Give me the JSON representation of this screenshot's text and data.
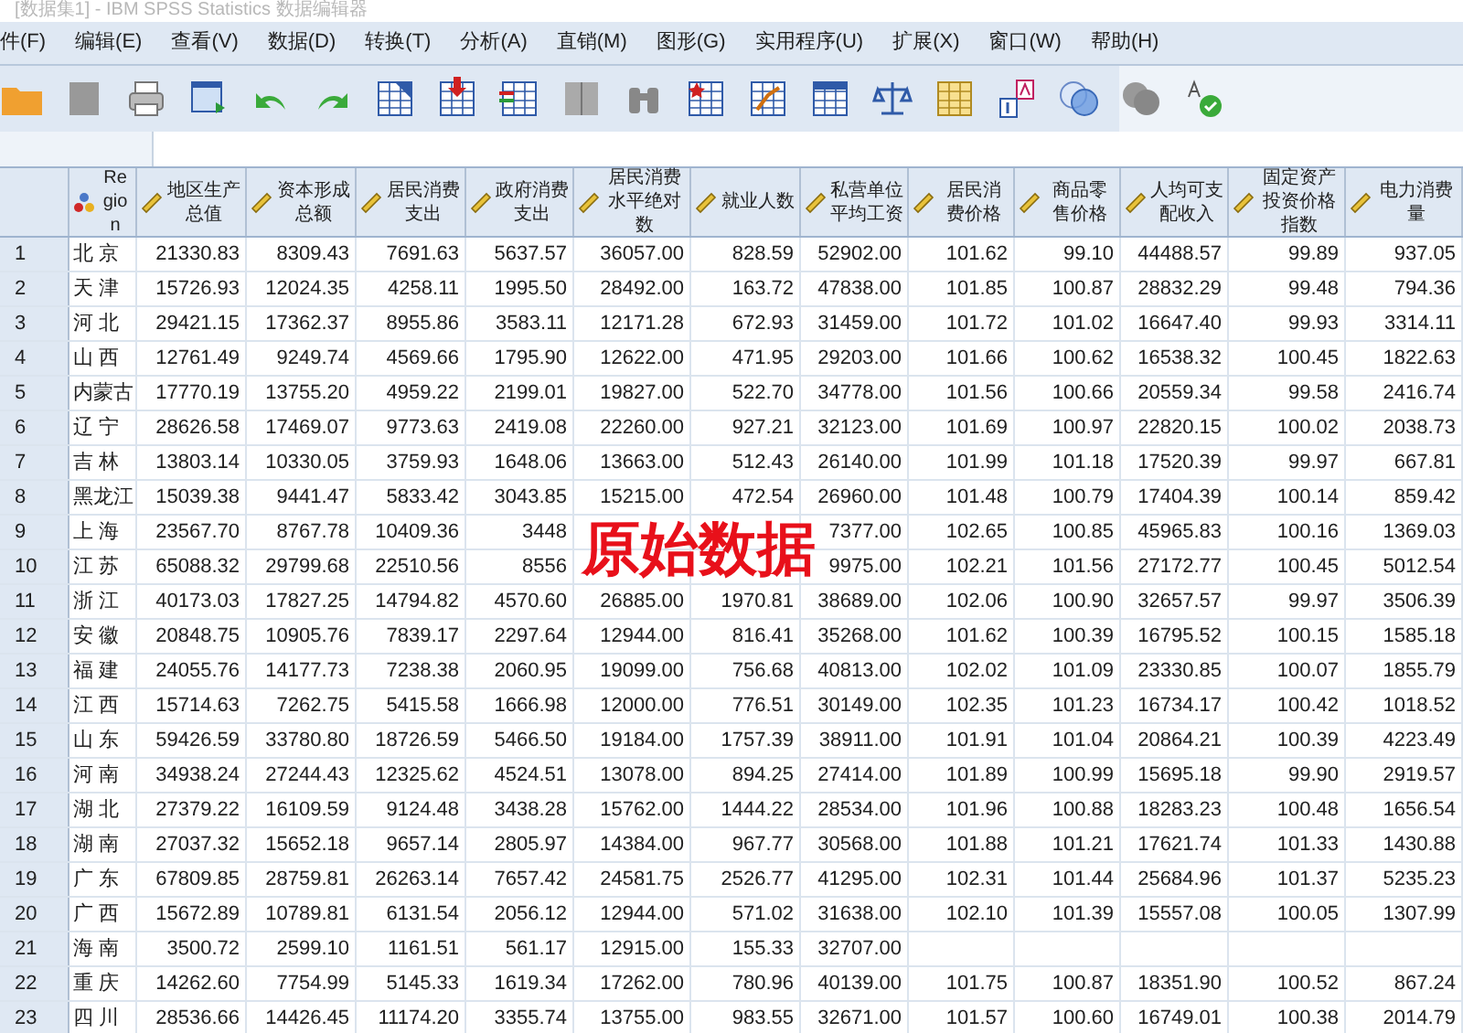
{
  "window": {
    "title": "[数据集1] - IBM SPSS Statistics 数据编辑器"
  },
  "menu": [
    "件(F)",
    "编辑(E)",
    "查看(V)",
    "数据(D)",
    "转换(T)",
    "分析(A)",
    "直销(M)",
    "图形(G)",
    "实用程序(U)",
    "扩展(X)",
    "窗口(W)",
    "帮助(H)"
  ],
  "table": {
    "columns": [
      {
        "label": "Region",
        "kind": "nominal"
      },
      {
        "label": "地区生产总值",
        "kind": "scale"
      },
      {
        "label": "资本形成总额",
        "kind": "scale"
      },
      {
        "label": "居民消费支出",
        "kind": "scale"
      },
      {
        "label": "政府消费支出",
        "kind": "scale"
      },
      {
        "label": "居民消费水平绝对数",
        "kind": "scale"
      },
      {
        "label": "就业人数",
        "kind": "scale"
      },
      {
        "label": "私营单位平均工资",
        "kind": "scale"
      },
      {
        "label": "居民消费价格",
        "kind": "scale"
      },
      {
        "label": "商品零售价格",
        "kind": "scale"
      },
      {
        "label": "人均可支配收入",
        "kind": "scale"
      },
      {
        "label": "固定资产投资价格指数",
        "kind": "scale"
      },
      {
        "label": "电力消费量",
        "kind": "scale"
      }
    ],
    "rows": [
      {
        "num": "1",
        "cells": [
          "北 京",
          "21330.83",
          "8309.43",
          "7691.63",
          "5637.57",
          "36057.00",
          "828.59",
          "52902.00",
          "101.62",
          "99.10",
          "44488.57",
          "99.89",
          "937.05"
        ]
      },
      {
        "num": "2",
        "cells": [
          "天 津",
          "15726.93",
          "12024.35",
          "4258.11",
          "1995.50",
          "28492.00",
          "163.72",
          "47838.00",
          "101.85",
          "100.87",
          "28832.29",
          "99.48",
          "794.36"
        ]
      },
      {
        "num": "3",
        "cells": [
          "河 北",
          "29421.15",
          "17362.37",
          "8955.86",
          "3583.11",
          "12171.28",
          "672.93",
          "31459.00",
          "101.72",
          "101.02",
          "16647.40",
          "99.93",
          "3314.11"
        ]
      },
      {
        "num": "4",
        "cells": [
          "山 西",
          "12761.49",
          "9249.74",
          "4569.66",
          "1795.90",
          "12622.00",
          "471.95",
          "29203.00",
          "101.66",
          "100.62",
          "16538.32",
          "100.45",
          "1822.63"
        ]
      },
      {
        "num": "5",
        "cells": [
          "内蒙古",
          "17770.19",
          "13755.20",
          "4959.22",
          "2199.01",
          "19827.00",
          "522.70",
          "34778.00",
          "101.56",
          "100.66",
          "20559.34",
          "99.58",
          "2416.74"
        ]
      },
      {
        "num": "6",
        "cells": [
          "辽 宁",
          "28626.58",
          "17469.07",
          "9773.63",
          "2419.08",
          "22260.00",
          "927.21",
          "32123.00",
          "101.69",
          "100.97",
          "22820.15",
          "100.02",
          "2038.73"
        ]
      },
      {
        "num": "7",
        "cells": [
          "吉 林",
          "13803.14",
          "10330.05",
          "3759.93",
          "1648.06",
          "13663.00",
          "512.43",
          "26140.00",
          "101.99",
          "101.18",
          "17520.39",
          "99.97",
          "667.81"
        ]
      },
      {
        "num": "8",
        "cells": [
          "黑龙江",
          "15039.38",
          "9441.47",
          "5833.42",
          "3043.85",
          "15215.00",
          "472.54",
          "26960.00",
          "101.48",
          "100.79",
          "17404.39",
          "100.14",
          "859.42"
        ]
      },
      {
        "num": "9",
        "cells": [
          "上 海",
          "23567.70",
          "8767.78",
          "10409.36",
          "3448",
          null,
          null,
          "7377.00",
          "102.65",
          "100.85",
          "45965.83",
          "100.16",
          "1369.03"
        ]
      },
      {
        "num": "10",
        "cells": [
          "江 苏",
          "65088.32",
          "29799.68",
          "22510.56",
          "8556",
          null,
          null,
          "9975.00",
          "102.21",
          "101.56",
          "27172.77",
          "100.45",
          "5012.54"
        ]
      },
      {
        "num": "11",
        "cells": [
          "浙 江",
          "40173.03",
          "17827.25",
          "14794.82",
          "4570.60",
          "26885.00",
          "1970.81",
          "38689.00",
          "102.06",
          "100.90",
          "32657.57",
          "99.97",
          "3506.39"
        ]
      },
      {
        "num": "12",
        "cells": [
          "安 徽",
          "20848.75",
          "10905.76",
          "7839.17",
          "2297.64",
          "12944.00",
          "816.41",
          "35268.00",
          "101.62",
          "100.39",
          "16795.52",
          "100.15",
          "1585.18"
        ]
      },
      {
        "num": "13",
        "cells": [
          "福 建",
          "24055.76",
          "14177.73",
          "7238.38",
          "2060.95",
          "19099.00",
          "756.68",
          "40813.00",
          "102.02",
          "101.09",
          "23330.85",
          "100.07",
          "1855.79"
        ]
      },
      {
        "num": "14",
        "cells": [
          "江 西",
          "15714.63",
          "7262.75",
          "5415.58",
          "1666.98",
          "12000.00",
          "776.51",
          "30149.00",
          "102.35",
          "101.23",
          "16734.17",
          "100.42",
          "1018.52"
        ]
      },
      {
        "num": "15",
        "cells": [
          "山 东",
          "59426.59",
          "33780.80",
          "18726.59",
          "5466.50",
          "19184.00",
          "1757.39",
          "38911.00",
          "101.91",
          "101.04",
          "20864.21",
          "100.39",
          "4223.49"
        ]
      },
      {
        "num": "16",
        "cells": [
          "河 南",
          "34938.24",
          "27244.43",
          "12325.62",
          "4524.51",
          "13078.00",
          "894.25",
          "27414.00",
          "101.89",
          "100.99",
          "15695.18",
          "99.90",
          "2919.57"
        ]
      },
      {
        "num": "17",
        "cells": [
          "湖 北",
          "27379.22",
          "16109.59",
          "9124.48",
          "3438.28",
          "15762.00",
          "1444.22",
          "28534.00",
          "101.96",
          "100.88",
          "18283.23",
          "100.48",
          "1656.54"
        ]
      },
      {
        "num": "18",
        "cells": [
          "湖 南",
          "27037.32",
          "15652.18",
          "9657.14",
          "2805.97",
          "14384.00",
          "967.77",
          "30568.00",
          "101.88",
          "101.21",
          "17621.74",
          "101.33",
          "1430.88"
        ]
      },
      {
        "num": "19",
        "cells": [
          "广 东",
          "67809.85",
          "28759.81",
          "26263.14",
          "7657.42",
          "24581.75",
          "2526.77",
          "41295.00",
          "102.31",
          "101.44",
          "25684.96",
          "101.37",
          "5235.23"
        ]
      },
      {
        "num": "20",
        "cells": [
          "广 西",
          "15672.89",
          "10789.81",
          "6131.54",
          "2056.12",
          "12944.00",
          "571.02",
          "31638.00",
          "102.10",
          "101.39",
          "15557.08",
          "100.05",
          "1307.99"
        ]
      },
      {
        "num": "21",
        "cells": [
          "海 南",
          "3500.72",
          "2599.10",
          "1161.51",
          "561.17",
          "12915.00",
          "155.33",
          "32707.00",
          null,
          null,
          null,
          null,
          null
        ]
      },
      {
        "num": "22",
        "cells": [
          "重 庆",
          "14262.60",
          "7754.99",
          "5145.33",
          "1619.34",
          "17262.00",
          "780.96",
          "40139.00",
          "101.75",
          "100.87",
          "18351.90",
          "100.52",
          "867.24"
        ]
      },
      {
        "num": "23",
        "cells": [
          "四 川",
          "28536.66",
          "14426.45",
          "11174.20",
          "3355.74",
          "13755.00",
          "983.55",
          "32671.00",
          "101.57",
          "100.60",
          "16749.01",
          "100.38",
          "2014.79"
        ]
      }
    ]
  },
  "annotation": "原始数据"
}
